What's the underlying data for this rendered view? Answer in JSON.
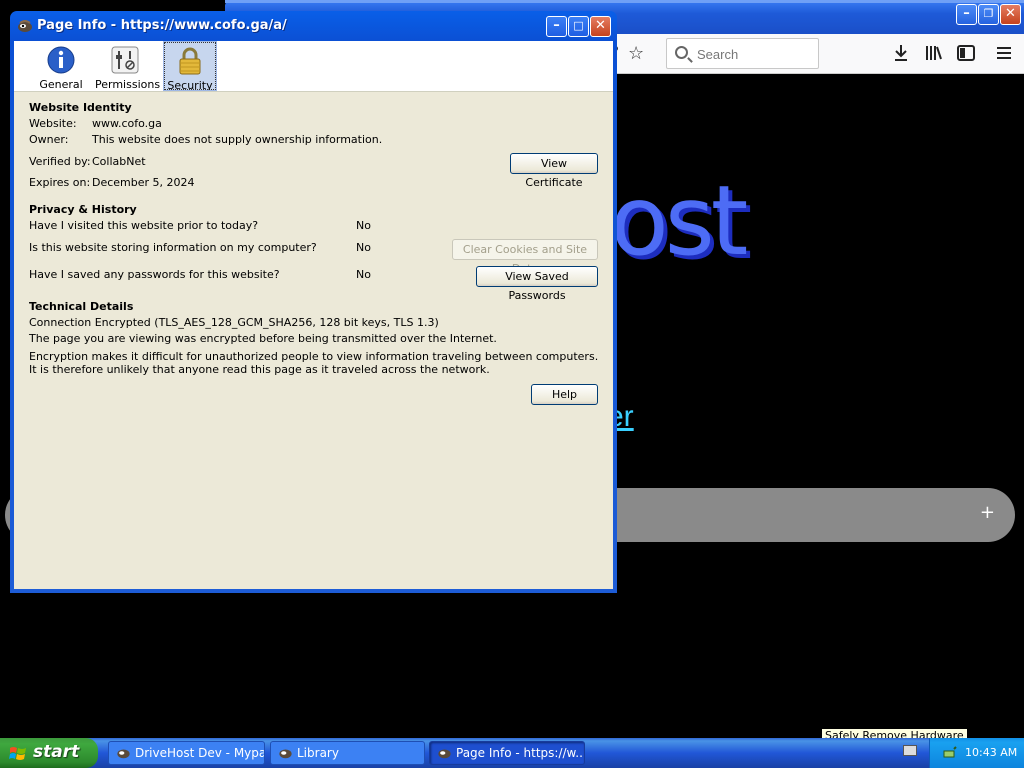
{
  "firefox": {
    "search_placeholder": "Search",
    "page_heading_fragment": "ost",
    "page_link_fragment": "er",
    "bar_plus": "+",
    "title_buttons": {
      "minimize": "–",
      "restore": "❐",
      "close": "✕"
    }
  },
  "dialog": {
    "title": "Page Info - https://www.cofo.ga/a/",
    "tabs": [
      {
        "label": "General",
        "icon": "info-icon"
      },
      {
        "label": "Permissions",
        "icon": "permissions-icon"
      },
      {
        "label": "Security",
        "icon": "lock-icon",
        "active": true
      }
    ],
    "identity": {
      "heading": "Website Identity",
      "website_label": "Website:",
      "website_value": "www.cofo.ga",
      "owner_label": "Owner:",
      "owner_value": "This website does not supply ownership information.",
      "verified_label": "Verified by:",
      "verified_value": "CollabNet",
      "expires_label": "Expires on:",
      "expires_value": "December 5, 2024",
      "view_certificate": "View Certificate"
    },
    "privacy": {
      "heading": "Privacy & History",
      "q1": "Have I visited this website prior to today?",
      "a1": "No",
      "q2": "Is this website storing information on my computer?",
      "a2": "No",
      "q3": "Have I saved any passwords for this website?",
      "a3": "No",
      "clear_cookies": "Clear Cookies and Site Data",
      "view_passwords": "View Saved Passwords"
    },
    "technical": {
      "heading": "Technical Details",
      "line1": "Connection Encrypted (TLS_AES_128_GCM_SHA256, 128 bit keys, TLS 1.3)",
      "line2": "The page you are viewing was encrypted before being transmitted over the Internet.",
      "line3": "Encryption makes it difficult for unauthorized people to view information traveling between computers. It is therefore unlikely that anyone read this page as it traveled across the network."
    },
    "help": "Help"
  },
  "taskbar": {
    "start": "start",
    "items": [
      {
        "label": "DriveHost Dev - Mypal",
        "active": false
      },
      {
        "label": "Library",
        "active": false
      },
      {
        "label": "Page Info - https://w...",
        "active": true
      }
    ],
    "time": "10:43 AM",
    "tooltip": "Safely Remove Hardware"
  },
  "colors": {
    "xp_blue": "#0b50d4",
    "dialog_face": "#ece9d8",
    "start_green": "#3fa83f",
    "page_heading": "#4d6cf5",
    "page_link": "#3ad0ff"
  }
}
